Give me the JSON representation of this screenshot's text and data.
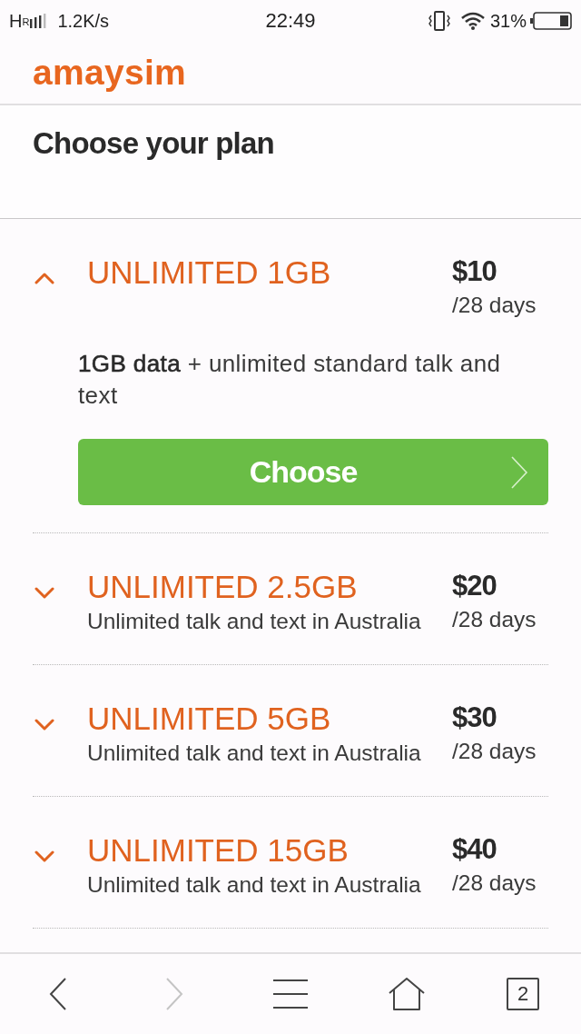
{
  "status_bar": {
    "network": "H",
    "roaming": "R",
    "speed": "1.2K/s",
    "time": "22:49",
    "battery": "31%"
  },
  "header": {
    "logo": "amaysim"
  },
  "page_title": "Choose your plan",
  "plans": [
    {
      "name": "UNLIMITED 1GB",
      "price": "$10",
      "period": "/28 days",
      "expanded": true,
      "description": "**1GB data** + unlimited standard talk and text",
      "action": "Choose"
    },
    {
      "name": "UNLIMITED 2.5GB",
      "price": "$20",
      "period": "/28 days",
      "expanded": false,
      "subtitle": "Unlimited talk and text in Australia"
    },
    {
      "name": "UNLIMITED 5GB",
      "price": "$30",
      "period": "/28 days",
      "expanded": false,
      "subtitle": "Unlimited talk and text in Australia"
    },
    {
      "name": "UNLIMITED 15GB",
      "price": "$40",
      "period": "/28 days",
      "expanded": false,
      "subtitle": "Unlimited talk and text in Australia"
    }
  ],
  "browser_toolbar": {
    "back": {
      "disabled": false
    },
    "forward": {
      "disabled": true
    },
    "tabs_count": "2"
  }
}
